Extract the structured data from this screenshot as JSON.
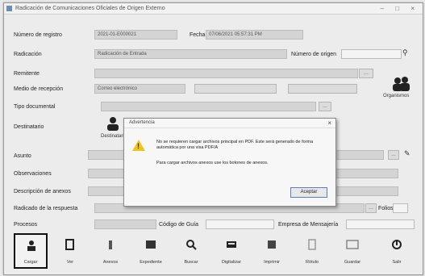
{
  "window": {
    "title": "Radicación de Comunicaciones Oficiales de Origen Externo"
  },
  "form": {
    "numero_registro_label": "Número de registro",
    "numero_registro_value": "2021-01-E000021",
    "fecha_label": "Fecha",
    "fecha_value": "07/06/2021 05:57:31 PM",
    "radicacion_label": "Radicación",
    "radicacion_value": "Radicación de Entrada",
    "numero_origen_label": "Número de origen",
    "remitente_label": "Remitente",
    "remitente_value": "",
    "medio_recepcion_label": "Medio de recepción",
    "medio_recepcion_value": "Correo electrónico",
    "tipo_documental_label": "Tipo documental",
    "tipo_documental_value": "",
    "destinatario_label": "Destinatario",
    "asunto_label": "Asunto",
    "observaciones_label": "Observaciones",
    "descripcion_anexos_label": "Descripción de anexos",
    "radicado_referencia_label": "Radicado de la respuesta",
    "folios_label": "Folios",
    "folios_value": "",
    "procesos_label": "Procesos",
    "codigo_guia_label": "Código de Guía",
    "empresa_mensajeria_label": "Empresa de Mensajería",
    "organismo_caption": "Organismos",
    "destinatario_caption": "Destinatario"
  },
  "dialog": {
    "title": "Advertencia",
    "close": "×",
    "message1": "No se requieren cargar archivos principal en PDF. Este será generado de forma automática por una visa PDF/A",
    "message2": "Para cargar archivos anexos use los botones de anexos.",
    "button": "Aceptar"
  },
  "toolbar": {
    "items": [
      {
        "label": "Cargar"
      },
      {
        "label": "Ver"
      },
      {
        "label": "Anexos"
      },
      {
        "label": "Expediente"
      },
      {
        "label": "Buscar"
      },
      {
        "label": "Digitalizar"
      },
      {
        "label": "Imprimir"
      },
      {
        "label": "Rótulo"
      },
      {
        "label": "Guardar"
      },
      {
        "label": "Salir"
      }
    ]
  }
}
